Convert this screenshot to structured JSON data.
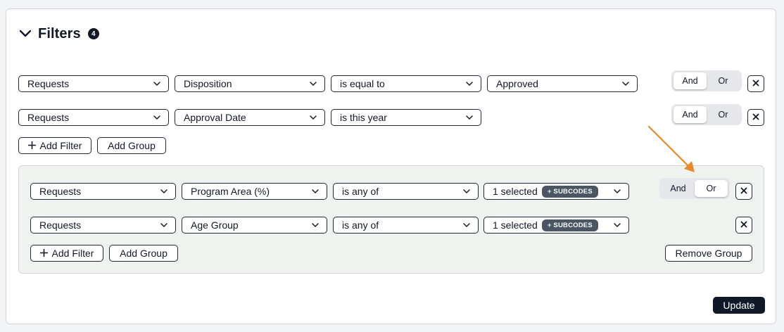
{
  "filters": {
    "title": "Filters",
    "count": "4"
  },
  "top_rows": [
    {
      "entity": "Requests",
      "field": "Disposition",
      "operator": "is equal to",
      "value": "Approved",
      "toggle": {
        "and": "And",
        "or": "Or",
        "selected": "And"
      }
    },
    {
      "entity": "Requests",
      "field": "Approval Date",
      "operator": "is this year",
      "toggle": {
        "and": "And",
        "or": "Or",
        "selected": "And"
      }
    }
  ],
  "top_actions": {
    "add_filter": "Add Filter",
    "add_group": "Add Group"
  },
  "group": {
    "rows": [
      {
        "entity": "Requests",
        "field": "Program Area (%)",
        "operator": "is any of",
        "value": "1 selected",
        "badge": "+ SUBCODES",
        "toggle": {
          "and": "And",
          "or": "Or",
          "selected": "Or"
        }
      },
      {
        "entity": "Requests",
        "field": "Age Group",
        "operator": "is any of",
        "value": "1 selected",
        "badge": "+ SUBCODES"
      }
    ],
    "add_filter": "Add Filter",
    "add_group": "Add Group",
    "remove_group": "Remove Group"
  },
  "update_label": "Update",
  "colors": {
    "annotation_arrow": "#e8892c",
    "dark": "#111827",
    "badge": "#4b5563",
    "group_bg": "#f0f2f0"
  }
}
